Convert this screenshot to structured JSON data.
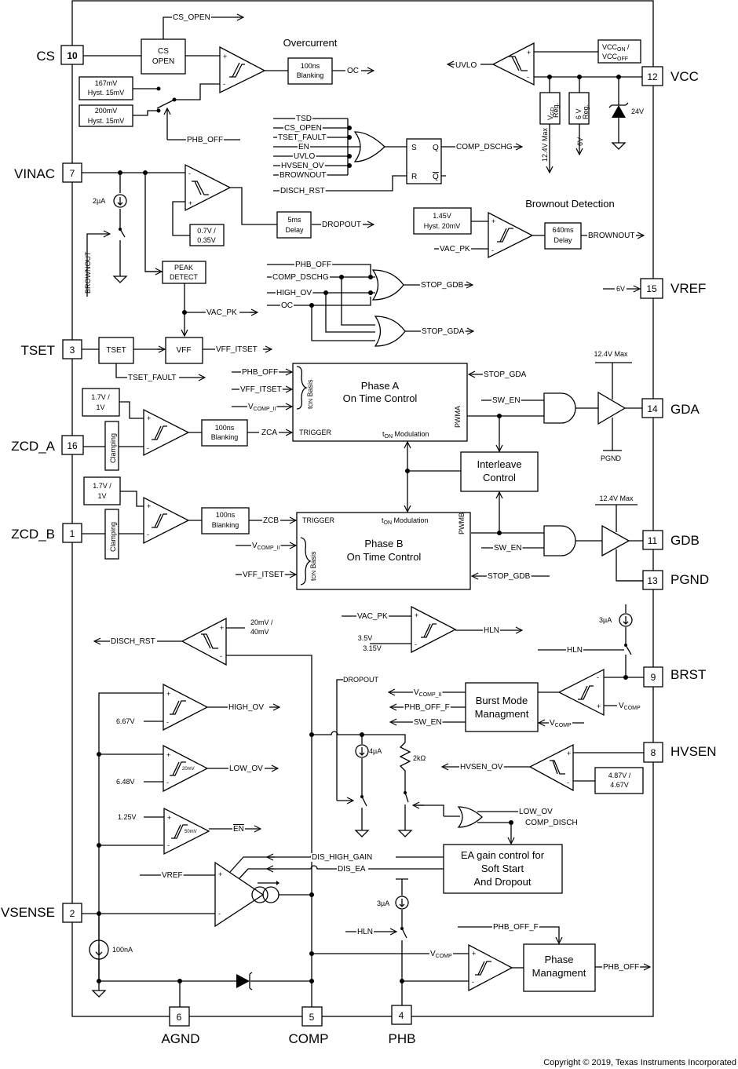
{
  "pins": {
    "cs": {
      "num": "10",
      "name": "CS"
    },
    "vinac": {
      "num": "7",
      "name": "VINAC"
    },
    "tset": {
      "num": "3",
      "name": "TSET"
    },
    "zcd_a": {
      "num": "16",
      "name": "ZCD_A"
    },
    "zcd_b": {
      "num": "1",
      "name": "ZCD_B"
    },
    "vsense": {
      "num": "2",
      "name": "VSENSE"
    },
    "agnd": {
      "num": "6",
      "name": "AGND"
    },
    "comp": {
      "num": "5",
      "name": "COMP"
    },
    "phb": {
      "num": "4",
      "name": "PHB"
    },
    "vcc": {
      "num": "12",
      "name": "VCC"
    },
    "vref": {
      "num": "15",
      "name": "VREF"
    },
    "gda": {
      "num": "14",
      "name": "GDA"
    },
    "gdb": {
      "num": "11",
      "name": "GDB"
    },
    "pgnd": {
      "num": "13",
      "name": "PGND"
    },
    "brst": {
      "num": "9",
      "name": "BRST"
    },
    "hvsen": {
      "num": "8",
      "name": "HVSEN"
    }
  },
  "section_titles": {
    "overcurrent": "Overcurrent",
    "brownout_detection": "Brownout Detection"
  },
  "blocks": {
    "cs_open": [
      "CS",
      "OPEN"
    ],
    "ref_167": [
      "167mV",
      "Hyst. 15mV"
    ],
    "ref_200": [
      "200mV",
      "Hyst. 15mV"
    ],
    "blanking_oc": [
      "100ns",
      "Blanking"
    ],
    "vcc_on_off": {
      "main1": "VCC",
      "sub1": "ON",
      "sep": " /",
      "main2": "VCC",
      "sub2": "OFF"
    },
    "vgd_reg": {
      "main": "V",
      "sub": "GD",
      "line2": "Reg."
    },
    "reg_6v": [
      "6 V",
      "Reg."
    ],
    "zener": "24V",
    "sr_latch": {
      "s": "S",
      "q": "Q",
      "r": "R",
      "qbar": "Q"
    },
    "ref_07": [
      "0.7V /",
      "0.35V"
    ],
    "delay_5ms": [
      "5ms",
      "Delay"
    ],
    "ref_145": [
      "1.45V",
      "Hyst. 20mV"
    ],
    "delay_640ms": [
      "640ms",
      "Delay"
    ],
    "peak_detect": [
      "PEAK",
      "DETECT"
    ],
    "tset": "TSET",
    "vff": "VFF",
    "ref_zcd_a": [
      "1.7V /",
      "1V"
    ],
    "ref_zcd_b": [
      "1.7V /",
      "1V"
    ],
    "clamping_a": "Clamping",
    "clamping_b": "Clamping",
    "blanking_a": [
      "100ns",
      "Blanking"
    ],
    "blanking_b": [
      "100ns",
      "Blanking"
    ],
    "phase_a": {
      "title": [
        "Phase A",
        "On Time Control"
      ],
      "trigger": "TRIGGER",
      "ton_mod": "Modulation",
      "ton_basis": "Basis",
      "pwm": "PWMA"
    },
    "phase_b": {
      "title": [
        "Phase B",
        "On Time Control"
      ],
      "trigger": "TRIGGER",
      "ton_mod": "Modulation",
      "ton_basis": "Basis",
      "pwm": "PWMB"
    },
    "interleave": [
      "Interleave",
      "Control"
    ],
    "gda_max": "12.4V Max",
    "gdb_max": "12.4V Max",
    "pgnd_label": "PGND",
    "burst_mode": [
      "Burst Mode",
      "Managment"
    ],
    "ref_hvsen": [
      "4.87V /",
      "4.67V"
    ],
    "ea_gain": [
      "EA gain control for",
      "Soft Start",
      "And Dropout"
    ],
    "phase_mgmt": [
      "Phase",
      "Managment"
    ]
  },
  "values": {
    "i_2ua": "2µA",
    "i_3ua_brst": "3µA",
    "i_4ua": "4µA",
    "r_2k": "2kΩ",
    "i_100na": "100nA",
    "i_3ua_phb": "3µA",
    "ref_20_40": [
      "20mV /",
      "40mV"
    ],
    "ref_667": "6.67V",
    "ref_648": "6.48V",
    "ref_125": "1.25V",
    "hyst_20": "20mV",
    "hyst_50": "50mV",
    "ref_hln": [
      "3.5V",
      "3.15V"
    ],
    "vref_6v": "6V",
    "ldo_124": "12.4V Max",
    "ldo_6v": "6V"
  },
  "signals": {
    "cs_open": "CS_OPEN",
    "oc": "OC",
    "phb_off": "PHB_OFF",
    "uvlo": "UVLO",
    "or_inputs": [
      "TSD",
      "CS_OPEN",
      "TSET_FAULT",
      "EN",
      "UVLO",
      "HVSEN_OV",
      "BROWNOUT"
    ],
    "disch_rst": "DISCH_RST",
    "comp_dschg": "COMP_DSCHG",
    "dropout": "DROPOUT",
    "brownout_out": "BROWNOUT",
    "vac_pk_in": "VAC_PK",
    "brownout_switch": "BROWNOUT",
    "stop_inputs": [
      "PHB_OFF",
      "COMP_DSCHG",
      "HIGH_OV",
      "OC"
    ],
    "stop_gdb": "STOP_GDB",
    "stop_gda": "STOP_GDA",
    "vac_pk": "VAC_PK",
    "vff_itset": "VFF_ITSET",
    "tset_fault": "TSET_FAULT",
    "pa_in_phb_off": "PHB_OFF",
    "pa_in_vff_itset": "VFF_ITSET",
    "pa_in_vcomp": {
      "main": "V",
      "sub": "COMP_II"
    },
    "zca": "ZCA",
    "zcb": "ZCB",
    "pb_in_vcomp": {
      "main": "V",
      "sub": "COMP_II"
    },
    "pb_in_vff_itset": "VFF_ITSET",
    "stop_gda_in": "STOP_GDA",
    "stop_gdb_in": "STOP_GDB",
    "sw_en_a": "SW_EN",
    "sw_en_b": "SW_EN",
    "disch_rst_out": "DISCH_RST",
    "hln_vac_pk": "VAC_PK",
    "hln": "HLN",
    "hln_brst": "HLN",
    "high_ov": "HIGH_OV",
    "low_ov": "LOW_OV",
    "en_out": "EN",
    "dropout_in": "DROPOUT",
    "bm_vcomp_ii": {
      "main": "V",
      "sub": "COMP_II"
    },
    "bm_phb_off_f": "PHB_OFF_F",
    "bm_sw_en": "SW_EN",
    "bm_vcomp_in": {
      "main": "V",
      "sub": "COMP"
    },
    "brst_vcomp": {
      "main": "V",
      "sub": "COMP"
    },
    "hvsen_ov": "HVSEN_OV",
    "or_low_ov": "LOW_OV",
    "or_comp_disch": "COMP_DISCH",
    "dis_high_gain": "DIS_HIGH_GAIN",
    "dis_ea": "DIS_EA",
    "vref_in": "VREF",
    "hln_phb": "HLN",
    "phb_vcomp": {
      "main": "V",
      "sub": "COMP"
    },
    "phb_off_f_in": "PHB_OFF_F",
    "phb_off_out": "PHB_OFF"
  },
  "copyright": "Copyright © 2019, Texas Instruments Incorporated"
}
